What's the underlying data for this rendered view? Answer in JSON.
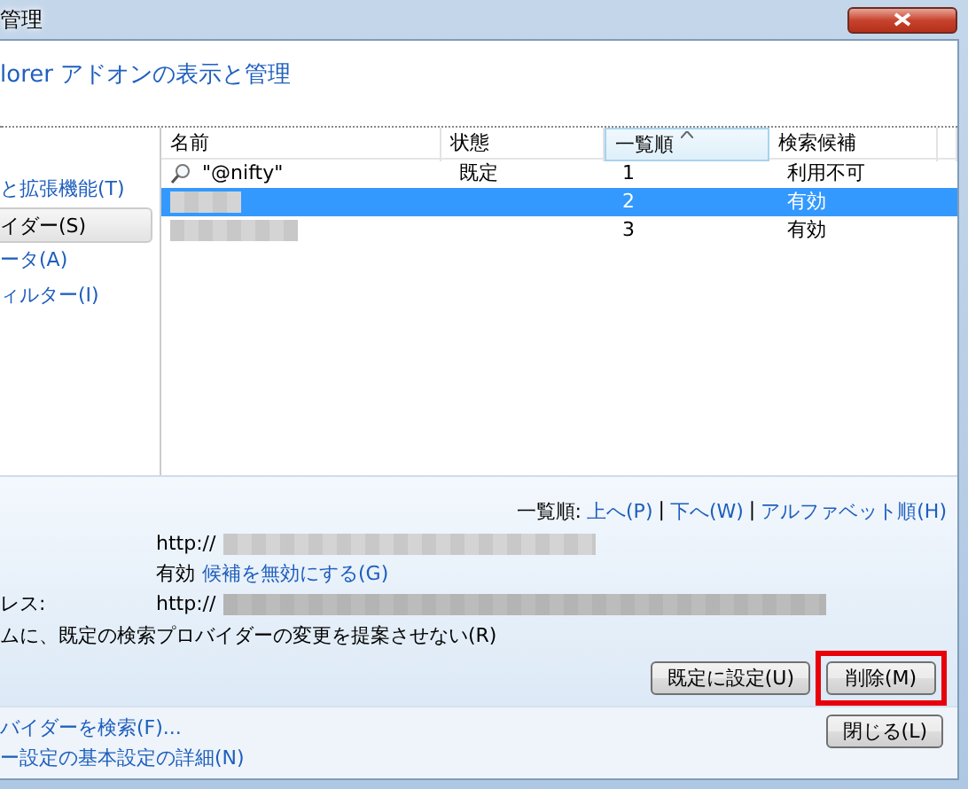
{
  "window": {
    "title": "管理"
  },
  "header": {
    "title": "lorer アドオンの表示と管理"
  },
  "sidebar": {
    "items": [
      {
        "label": "と拡張機能(T)",
        "selected": false
      },
      {
        "label": "イダー(S)",
        "selected": true
      },
      {
        "label": "ータ(A)",
        "selected": false
      },
      {
        "label": "ィルター(I)",
        "selected": false
      }
    ]
  },
  "list": {
    "columns": [
      {
        "label": "名前",
        "sorted": false
      },
      {
        "label": "状態",
        "sorted": false
      },
      {
        "label": "一覧順",
        "sorted": true
      },
      {
        "label": "検索候補",
        "sorted": false
      }
    ],
    "rows": [
      {
        "name": "\"@nifty\"",
        "name_redacted": false,
        "status": "既定",
        "order": "1",
        "suggestions": "利用不可",
        "selected": false
      },
      {
        "name_redacted": true,
        "order": "2",
        "suggestions": "有効",
        "selected": true
      },
      {
        "name_redacted": true,
        "order": "3",
        "suggestions": "有効",
        "selected": false
      }
    ]
  },
  "details": {
    "sort_label": "一覧順:",
    "link_separator": "|",
    "sort_links": [
      "上へ(P)",
      "下へ(W)",
      "アルファベット順(H)"
    ],
    "fields": [
      {
        "kind": "url",
        "value": "http://"
      },
      {
        "kind": "status",
        "value": "有効",
        "link": "候補を無効にする(G)"
      },
      {
        "kind": "url",
        "label": "レス:",
        "value": "http://"
      }
    ],
    "option": "ムに、既定の検索プロバイダーの変更を提案させない(R)",
    "buttons": [
      {
        "label": "既定に設定(U)",
        "highlighted": false
      },
      {
        "label": "削除(M)",
        "highlighted": true
      }
    ]
  },
  "footer": {
    "links": [
      "バイダーを検索(F)...",
      "ー設定の基本設定の詳細(N)"
    ],
    "close_button": "閉じる(L)"
  }
}
